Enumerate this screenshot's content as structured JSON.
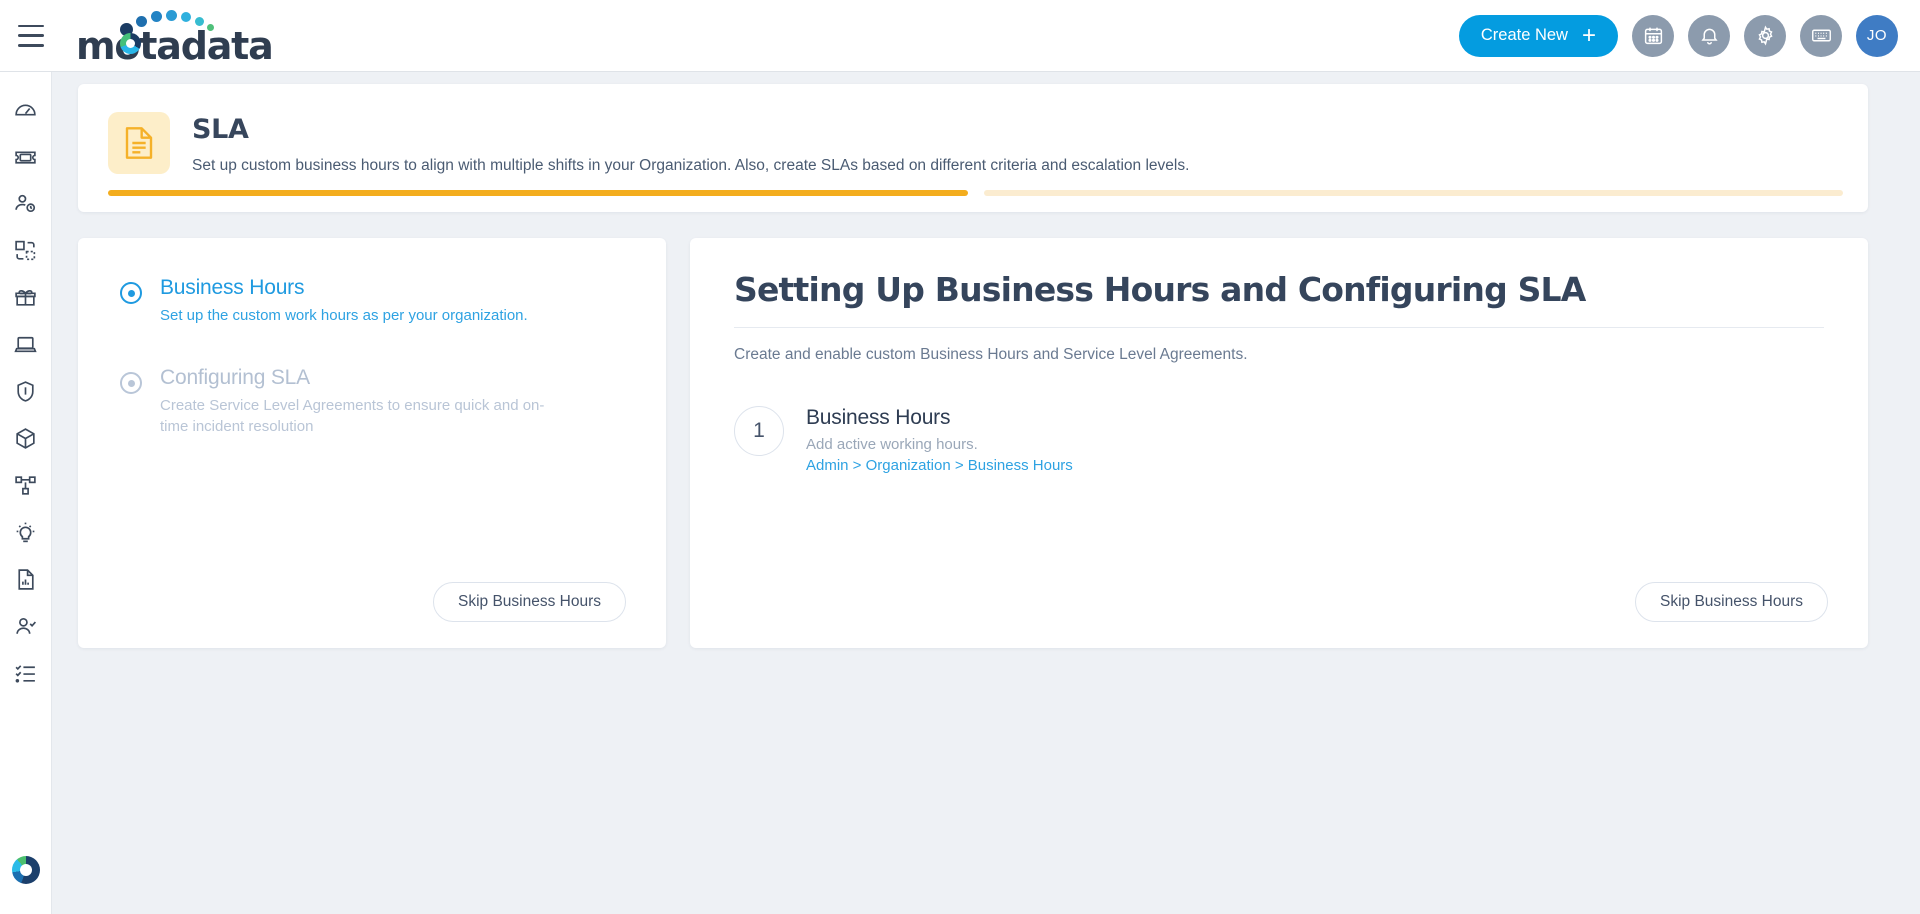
{
  "topbar": {
    "menu_icon": "hamburger-icon",
    "brand": "motadata",
    "create_new_label": "Create New",
    "create_new_plus": "+",
    "icons": [
      {
        "name": "calendar-icon"
      },
      {
        "name": "bell-icon"
      },
      {
        "name": "gear-icon"
      },
      {
        "name": "keyboard-icon"
      }
    ],
    "avatar_initials": "JO",
    "accent_color": "#049ce0",
    "avatar_color": "#3f7cc4"
  },
  "sidebar": {
    "items": [
      {
        "name": "dashboard-icon"
      },
      {
        "name": "ticket-icon"
      },
      {
        "name": "user-clock-icon"
      },
      {
        "name": "change-icon"
      },
      {
        "name": "release-box-icon"
      },
      {
        "name": "laptop-icon"
      },
      {
        "name": "shield-icon"
      },
      {
        "name": "cube-icon"
      },
      {
        "name": "network-nodes-icon"
      },
      {
        "name": "lightbulb-icon"
      },
      {
        "name": "report-icon"
      },
      {
        "name": "user-check-icon"
      },
      {
        "name": "checklist-icon"
      }
    ],
    "logo_name": "motadata-donut-logo"
  },
  "banner": {
    "icon_name": "sla-document-icon",
    "title": "SLA",
    "description": "Set up custom business hours to align with multiple shifts in your Organization. Also, create SLAs based on different criteria and escalation levels.",
    "progress": {
      "segments": [
        {
          "label": "Business Hours",
          "state": "done"
        },
        {
          "label": "Configuring SLA",
          "state": "todo"
        }
      ],
      "done_color": "#f3ad1e",
      "todo_color": "#fbecd0"
    }
  },
  "left_panel": {
    "steps": [
      {
        "title": "Business Hours",
        "description": "Set up the custom work hours as per your organization.",
        "state": "active"
      },
      {
        "title": "Configuring SLA",
        "description": "Create Service Level Agreements to ensure quick and on-time incident resolution",
        "state": "inactive"
      }
    ],
    "skip_label": "Skip Business Hours"
  },
  "right_panel": {
    "heading": "Setting Up Business Hours and Configuring SLA",
    "subheading": "Create and enable custom Business Hours and Service Level Agreements.",
    "tasks": [
      {
        "number": "1",
        "title": "Business Hours",
        "description": "Add active working hours.",
        "path": "Admin > Organization > Business Hours"
      }
    ],
    "skip_label": "Skip Business Hours"
  }
}
